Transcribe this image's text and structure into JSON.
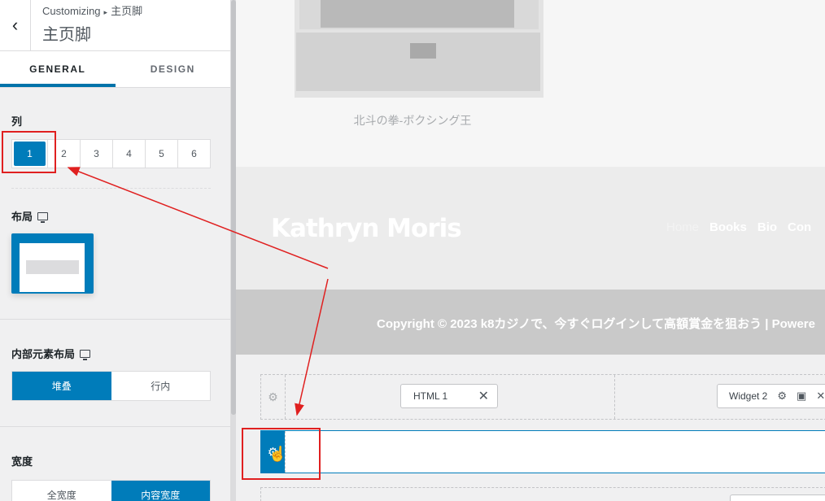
{
  "sidebar": {
    "breadcrumb_root": "Customizing",
    "breadcrumb_sep": "▸",
    "breadcrumb_current": "主页脚",
    "title": "主页脚",
    "tabs": [
      {
        "label": "GENERAL"
      },
      {
        "label": "DESIGN"
      }
    ],
    "columns": {
      "label": "列",
      "options": [
        "1",
        "2",
        "3",
        "4",
        "5",
        "6"
      ]
    },
    "layout": {
      "label": "布局"
    },
    "inner_layout": {
      "label": "内部元素布局",
      "options": [
        "堆叠",
        "行内"
      ]
    },
    "width": {
      "label": "宽度",
      "options": [
        "全宽度",
        "内容宽度"
      ]
    }
  },
  "preview": {
    "caption": "北斗の拳-ボクシング王",
    "brand": "Kathryn Moris",
    "menu": [
      "Home",
      "Books",
      "Bio",
      "Con"
    ],
    "copyright": "Copyright © 2023 k8カジノで、今すぐログインして高額賞金を狙おう | Powere"
  },
  "builder": {
    "chip1": "HTML 1",
    "chip2": "Widget 2"
  },
  "colors": {
    "accent": "#007cba",
    "annotation": "#e02020"
  }
}
